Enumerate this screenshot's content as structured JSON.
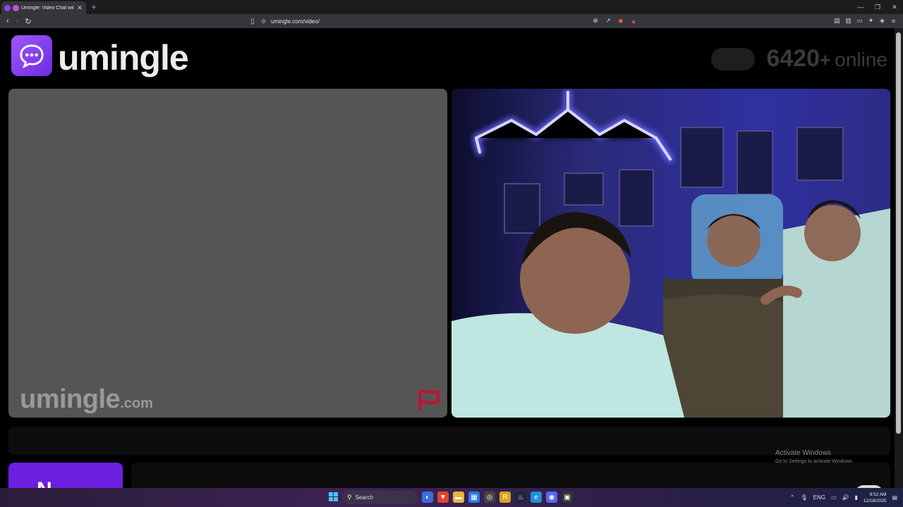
{
  "browser": {
    "tab_title": "Umingle: Video Chat with Str",
    "tab_close": "✕",
    "new_tab": "+",
    "url": "umingle.com/video/",
    "window_controls": [
      "—",
      "❐",
      "✕"
    ]
  },
  "site": {
    "logo_text": "umingle",
    "online_count": "6420",
    "online_plus": "+",
    "online_word": "online",
    "watermark_main": "umingle",
    "watermark_tld": ".com",
    "next_button_label": "N",
    "brand_color": "#7b2ff0"
  },
  "overlay": {
    "activate_title": "Activate Windows",
    "activate_sub": "Go to Settings to activate Windows."
  },
  "taskbar": {
    "search_label": "Search",
    "lang": "ENG",
    "time": "9:52 AM",
    "date": "12/18/2025"
  }
}
